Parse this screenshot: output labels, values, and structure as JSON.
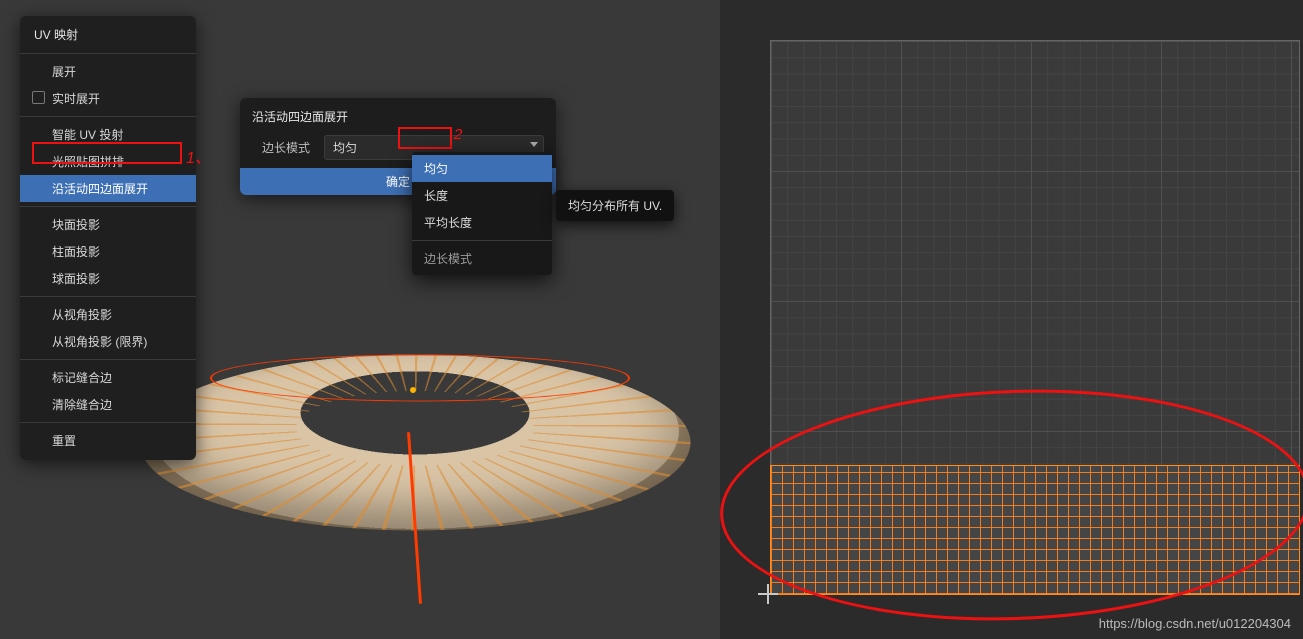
{
  "menu": {
    "title": "UV 映射",
    "items": [
      {
        "label": "展开"
      },
      {
        "label": "实时展开",
        "checkbox": true
      },
      {
        "label": "智能 UV 投射"
      },
      {
        "label": "光照贴图拼排"
      },
      {
        "label": "沿活动四边面展开",
        "active": true
      },
      {
        "label": "块面投影"
      },
      {
        "label": "柱面投影"
      },
      {
        "label": "球面投影"
      },
      {
        "label": "从视角投影"
      },
      {
        "label": "从视角投影 (限界)"
      },
      {
        "label": "标记缝合边"
      },
      {
        "label": "清除缝合边"
      },
      {
        "label": "重置"
      }
    ],
    "annotation_1": "1、"
  },
  "panel": {
    "title": "沿活动四边面展开",
    "row_label": "边长模式",
    "select_value": "均匀",
    "confirm": "确定",
    "annotation_2": "2"
  },
  "dropdown": {
    "options": [
      "均匀",
      "长度",
      "平均长度"
    ],
    "footer": "边长模式"
  },
  "tooltip": "均匀分布所有 UV.",
  "watermark": "https://blog.csdn.net/u012204304"
}
